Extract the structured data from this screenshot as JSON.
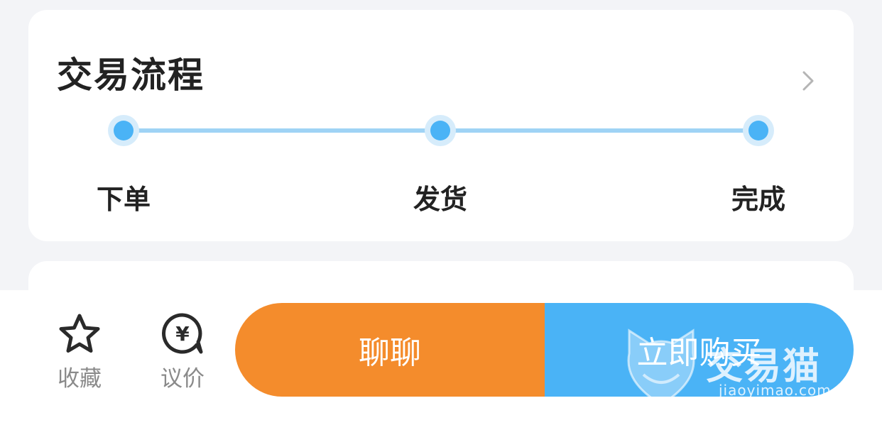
{
  "flow_card": {
    "title": "交易流程",
    "steps": [
      {
        "label": "下单"
      },
      {
        "label": "发货"
      },
      {
        "label": "完成"
      }
    ]
  },
  "bottom_bar": {
    "favorite_label": "收藏",
    "bargain_label": "议价",
    "chat_button": "聊聊",
    "buy_button": "立即购买"
  },
  "watermark": {
    "brand": "交易猫",
    "url": "jiaoyimao.com"
  },
  "icons": {
    "favorite": "star-outline-icon",
    "bargain": "yen-chat-bubble-icon",
    "more": "chevron-right-icon"
  },
  "colors": {
    "accent_blue": "#4ab3f6",
    "accent_orange": "#f48c2c",
    "track": "#9fd3f5",
    "background": "#f3f4f7"
  }
}
